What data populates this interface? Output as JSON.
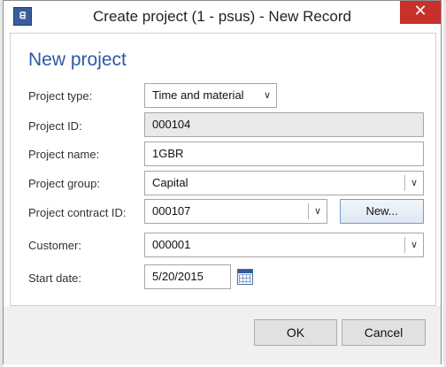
{
  "window": {
    "title": "Create project (1 - psus) - New Record",
    "app_icon": "dynamics-ax-icon",
    "close_glyph": "✕"
  },
  "form": {
    "title": "New project",
    "fields": {
      "project_type": {
        "label": "Project type:",
        "value": "Time and material"
      },
      "project_id": {
        "label": "Project ID:",
        "value": "000104"
      },
      "project_name": {
        "label": "Project name:",
        "value": "1GBR"
      },
      "project_group": {
        "label": "Project group:",
        "value": "Capital"
      },
      "project_contract_id": {
        "label": "Project contract ID:",
        "value": "000107",
        "new_button_label": "New..."
      },
      "customer": {
        "label": "Customer:",
        "value": "000001"
      },
      "start_date": {
        "label": "Start date:",
        "value": "5/20/2015"
      }
    }
  },
  "buttons": {
    "ok": "OK",
    "cancel": "Cancel"
  },
  "colors": {
    "title_blue": "#2c58a8",
    "close_red": "#c7302b",
    "readonly_bg": "#e9e9e9"
  }
}
